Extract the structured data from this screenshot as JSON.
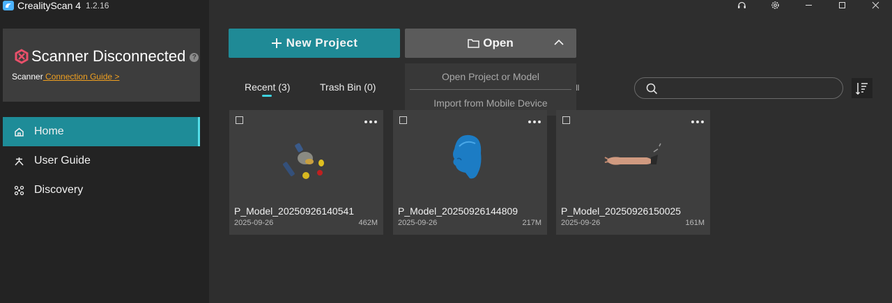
{
  "app": {
    "name": "CrealityScan 4",
    "version": "1.2.16"
  },
  "window_controls": [
    "support-icon",
    "settings-icon",
    "minimize-icon",
    "maximize-icon",
    "close-icon"
  ],
  "scanner": {
    "status": "Scanner Disconnected",
    "label": "Scanner",
    "guide_link": " Connection Guide >"
  },
  "nav": [
    {
      "label": "Home",
      "icon": "home-icon",
      "active": true
    },
    {
      "label": "User Guide",
      "icon": "user-guide-icon",
      "active": false
    },
    {
      "label": "Discovery",
      "icon": "discovery-icon",
      "active": false
    }
  ],
  "actions": {
    "new_project": "New Project",
    "open": "Open"
  },
  "open_menu": [
    "Open Project or Model",
    "Import from Mobile Device"
  ],
  "tabs": [
    "Recent (3)",
    "Trash Bin (0)"
  ],
  "tab_partial": "ll",
  "search": {
    "placeholder": ""
  },
  "projects": [
    {
      "name": "P_Model_20250926140541",
      "date": "2025-09-26",
      "size": "462M"
    },
    {
      "name": "P_Model_20250926144809",
      "date": "2025-09-26",
      "size": "217M"
    },
    {
      "name": "P_Model_20250926150025",
      "date": "2025-09-26",
      "size": "161M"
    }
  ],
  "colors": {
    "accent": "#1f8a96",
    "accent_light": "#54dde8",
    "link": "#f0a020",
    "sidebar_bg": "#232323",
    "main_bg": "#2e2e2e",
    "card_bg": "#3e3e3e",
    "status_icon": "#e8506a"
  }
}
